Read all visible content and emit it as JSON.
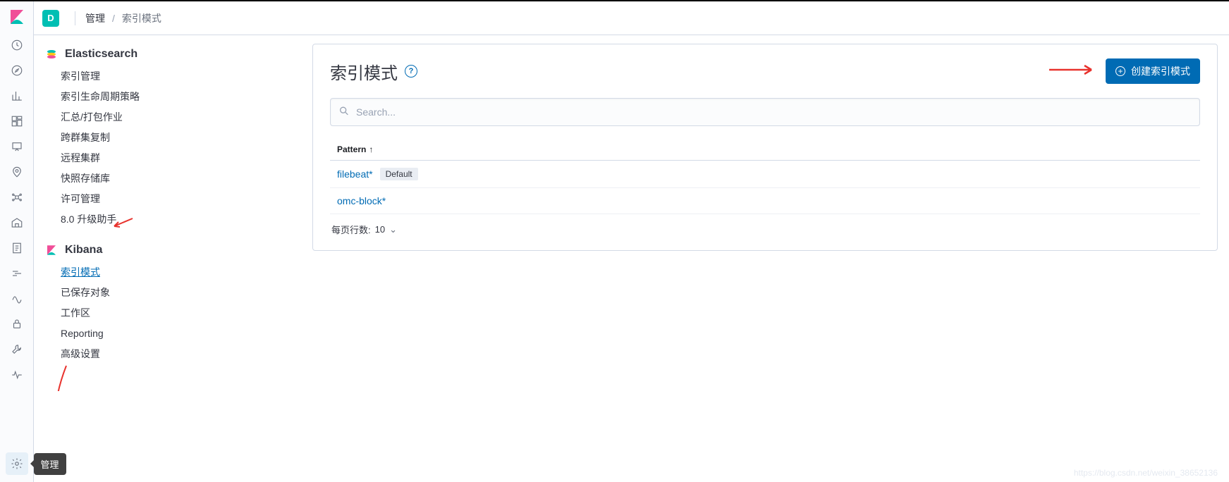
{
  "topbar": {
    "space_initial": "D",
    "breadcrumb": {
      "root": "管理",
      "current": "索引模式"
    }
  },
  "rail_tooltip": "管理",
  "sidebar": {
    "sections": [
      {
        "name": "Elasticsearch",
        "icon": "elasticsearch",
        "items": [
          {
            "label": "索引管理"
          },
          {
            "label": "索引生命周期策略"
          },
          {
            "label": "汇总/打包作业"
          },
          {
            "label": "跨群集复制"
          },
          {
            "label": "远程集群"
          },
          {
            "label": "快照存储库"
          },
          {
            "label": "许可管理"
          },
          {
            "label": "8.0 升级助手"
          }
        ]
      },
      {
        "name": "Kibana",
        "icon": "kibana",
        "items": [
          {
            "label": "索引模式",
            "active": true
          },
          {
            "label": "已保存对象"
          },
          {
            "label": "工作区"
          },
          {
            "label": "Reporting"
          },
          {
            "label": "高级设置"
          }
        ]
      }
    ]
  },
  "panel": {
    "title": "索引模式",
    "create_button": "创建索引模式",
    "search_placeholder": "Search...",
    "column_header": "Pattern",
    "rows": [
      {
        "name": "filebeat*",
        "default_badge": "Default"
      },
      {
        "name": "omc-block*"
      }
    ],
    "pager": {
      "label": "每页行数:",
      "value": "10"
    }
  },
  "watermark": "https://blog.csdn.net/weixin_38652136"
}
